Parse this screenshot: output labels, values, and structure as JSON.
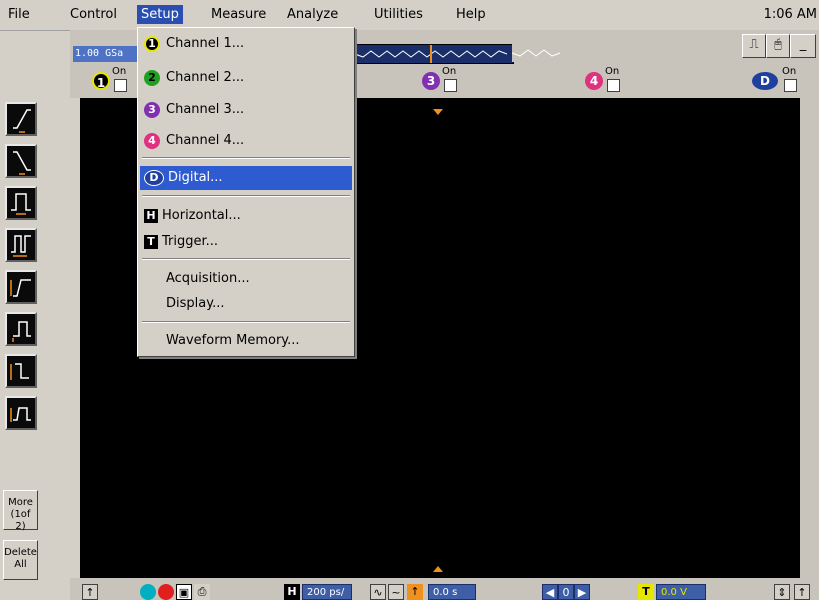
{
  "menubar": {
    "items": [
      "File",
      "Control",
      "Setup",
      "Measure",
      "Analyze",
      "Utilities",
      "Help"
    ],
    "active": "Setup",
    "clock": "1:06 AM"
  },
  "acquisition": {
    "sample_rate": "1.00 GSa"
  },
  "channels": [
    {
      "num": "1",
      "on_label": "On",
      "color": "#e6e600"
    },
    {
      "num": "3",
      "on_label": "On",
      "color": "#b030c0"
    },
    {
      "num": "4",
      "on_label": "On",
      "color": "#e040a0"
    },
    {
      "num": "D",
      "on_label": "On",
      "color": "#4070d0"
    }
  ],
  "setup_menu": {
    "items": [
      {
        "label": "Channel 1...",
        "icon": "1",
        "color": "#e6e600",
        "text_color": "#000"
      },
      {
        "label": "Channel 2...",
        "icon": "2",
        "color": "#20a020",
        "text_color": "#000"
      },
      {
        "label": "Channel 3...",
        "icon": "3",
        "color": "#8030b0",
        "text_color": "#fff"
      },
      {
        "label": "Channel 4...",
        "icon": "4",
        "color": "#e03080",
        "text_color": "#fff"
      },
      {
        "label": "Digital...",
        "icon": "D",
        "color": "#2040a0",
        "highlighted": true
      },
      {
        "label": "Horizontal...",
        "icon": "H"
      },
      {
        "label": "Trigger...",
        "icon": "T"
      },
      {
        "label": "Acquisition..."
      },
      {
        "label": "Display..."
      },
      {
        "label": "Waveform Memory..."
      }
    ]
  },
  "left_toolbar": {
    "more_label": "More\n(1of 2)",
    "more_line1": "More",
    "more_line2": "(1of 2)",
    "delete_line1": "Delete",
    "delete_line2": "All"
  },
  "bottom_bar": {
    "timebase": "200 ps/",
    "delay": "0.0 s",
    "trigger_level": "0.0 V",
    "nav_value": "0"
  },
  "colors": {
    "accent": "#2f5bd0",
    "trigger_marker": "#f09020",
    "screen": "#000000"
  }
}
